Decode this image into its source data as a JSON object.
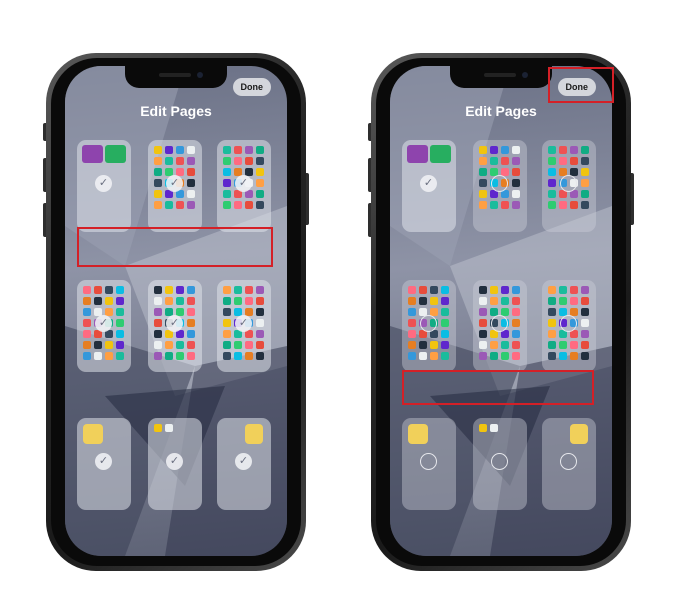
{
  "colors": {
    "highlight": "#d42027",
    "done_bg": "#d4d6dc"
  },
  "phones": [
    {
      "title": "Edit Pages",
      "done_label": "Done",
      "pages": [
        {
          "selected": true
        },
        {
          "selected": true
        },
        {
          "selected": true
        },
        {
          "selected": true
        },
        {
          "selected": true
        },
        {
          "selected": true
        },
        {
          "selected": true
        },
        {
          "selected": true
        },
        {
          "selected": true
        }
      ],
      "check_glyph": "✓"
    },
    {
      "title": "Edit Pages",
      "done_label": "Done",
      "pages": [
        {
          "selected": true
        },
        {
          "selected": false
        },
        {
          "selected": false
        },
        {
          "selected": false
        },
        {
          "selected": false
        },
        {
          "selected": false
        },
        {
          "selected": false
        },
        {
          "selected": false
        },
        {
          "selected": false
        }
      ],
      "check_glyph": "✓"
    }
  ]
}
